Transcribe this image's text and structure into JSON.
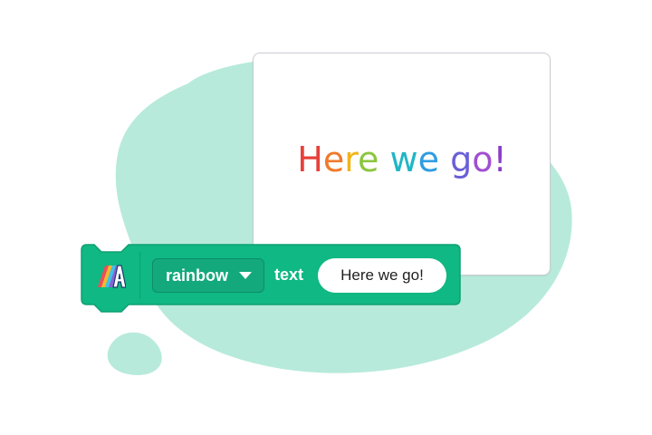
{
  "stage": {
    "display_text": "Here we go!",
    "rainbow_colors": [
      "#e8403a",
      "#f07a2a",
      "#f2b417",
      "#8cc63f",
      "#1fb6c6",
      "#2f9de0",
      "#6a5fd6",
      "#a14fd0",
      "#8a3fc8"
    ]
  },
  "block": {
    "extension_icon": "text-extension-icon",
    "color_dropdown": {
      "selected": "rainbow",
      "icon": "caret-down-icon"
    },
    "text_label": "text",
    "text_value": "Here we go!",
    "block_color": "#10b883",
    "block_border": "#0e9f72"
  },
  "background": {
    "blob_color": "#b7eadb"
  }
}
